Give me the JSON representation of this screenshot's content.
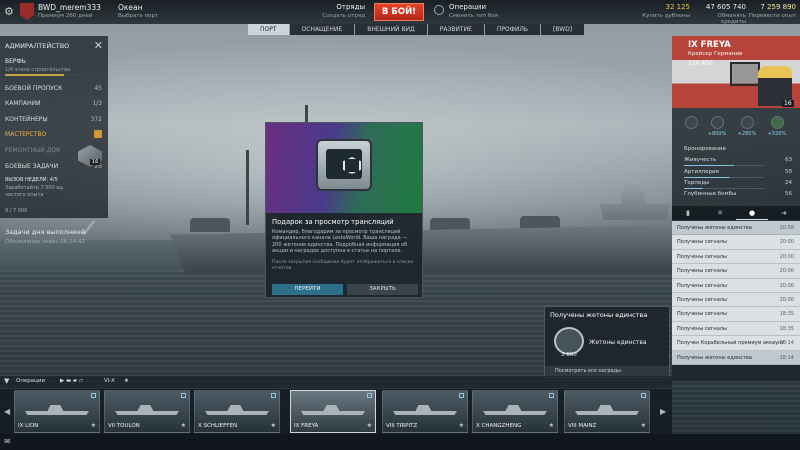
{
  "header": {
    "player_name": "BWD_merem333",
    "player_sub": "Премиум 260 дней",
    "mode": "Океан",
    "mode_sub": "Выбрать порт",
    "squad": "Отряды",
    "squad_sub": "Создать отряд",
    "battle": "В БОЙ!",
    "operations": "Операции",
    "operations_sub": "Сменить тип боя",
    "doubloons": "32 125",
    "doubloons_sub": "Купить дублоны",
    "credits": "47 605 740",
    "credits_sub": "Обменять кредиты",
    "freexp": "7 259 890",
    "freexp_sub": "Перевести опыт"
  },
  "nav": {
    "tabs": [
      "ПОРТ",
      "ОСНАЩЕНИЕ",
      "ВНЕШНИЙ ВИД",
      "РАЗВИТИЕ",
      "ПРОФИЛЬ",
      "[BWD]"
    ],
    "active": "ПОРТ"
  },
  "left": {
    "admiralty": "АДМИРАЛТЕЙСТВО",
    "shipyard": "ВЕРФЬ",
    "shipyard_sub": "1/4 этапа строительства",
    "shipyard_progress": 0.6,
    "items": [
      {
        "label": "БОЕВОЙ ПРОПУСК",
        "value": "45"
      },
      {
        "label": "КАМПАНИИ",
        "value": "1/3"
      },
      {
        "label": "КОНТЕЙНЕРЫ",
        "value": "372"
      },
      {
        "label": "МАСТЕРСТВО",
        "value": ""
      },
      {
        "label": "РЕМОНТНЫЙ ДОК",
        "value": ""
      },
      {
        "label": "БОЕВЫЕ ЗАДАЧИ",
        "value": "26"
      }
    ],
    "task_title": "ВЫЗОВ НЕДЕЛИ: 4/5",
    "task_sub1": "Заработайте 7 000 ед.",
    "task_sub2": "чистого опыта",
    "task_count": "9 / 7 000",
    "badge_num": "16",
    "done": "Задачи дня выполнены",
    "done_sub": "Обновление через 08:24:42"
  },
  "ship": {
    "name": "IX FREYA",
    "class": "Крейсер Германии",
    "stat": "210 400",
    "captain_level": "16",
    "mods": [
      "+800%",
      "+285%",
      "+520%"
    ],
    "stats": [
      {
        "label": "Бронирование",
        "value": ""
      },
      {
        "label": "Живучесть",
        "value": "63",
        "fill": 0.63
      },
      {
        "label": "Артиллерия",
        "value": "58",
        "fill": 0.58
      },
      {
        "label": "Торпеды",
        "value": "24",
        "fill": 0.24
      },
      {
        "label": "Глубинные бомбы",
        "value": "56",
        "fill": 0.56
      }
    ]
  },
  "notifications": [
    {
      "text": "Получены жетоны единства",
      "time": "20:58"
    },
    {
      "text": "Получены сигналы",
      "time": "20:00"
    },
    {
      "text": "Получены сигналы",
      "time": "20:00"
    },
    {
      "text": "Получены сигналы",
      "time": "20:00"
    },
    {
      "text": "Получены сигналы",
      "time": "20:00"
    },
    {
      "text": "Получены сигналы",
      "time": "20:00"
    },
    {
      "text": "Получены сигналы",
      "time": "18:35"
    },
    {
      "text": "Получены сигналы",
      "time": "18:35"
    },
    {
      "text": "Получен Корабельный премиум аккаунт",
      "time": "18:14"
    },
    {
      "text": "Получены жетоны единства",
      "time": "18:14"
    }
  ],
  "popup": {
    "title": "Получены жетоны единства",
    "item": "Жетоны единства",
    "count": "3 600",
    "footer": "Посмотреть все награды"
  },
  "modal": {
    "title": "Подарок за просмотр трансляций",
    "text": "Командир, благодарим за просмотр трансляций официального канала LestaWorld. Ваша награда — 200 жетонов единства. Подробная информация об акции и наградах доступна в статье на портале.",
    "note": "После закрытия сообщение будет отображаться в списке отчётов.",
    "go": "ПЕРЕЙТИ",
    "close": "ЗАКРЫТЬ"
  },
  "filter": {
    "label": "Операции",
    "tier": "VI-X"
  },
  "ships": [
    {
      "name": "IX LION"
    },
    {
      "name": "VII TOULON"
    },
    {
      "name": "X SCHLIEFFEN"
    },
    {
      "name": "IX FREYA"
    },
    {
      "name": "VIII TIRPITZ"
    },
    {
      "name": "X CHANGZHENG"
    },
    {
      "name": "VIII MAINZ"
    }
  ]
}
